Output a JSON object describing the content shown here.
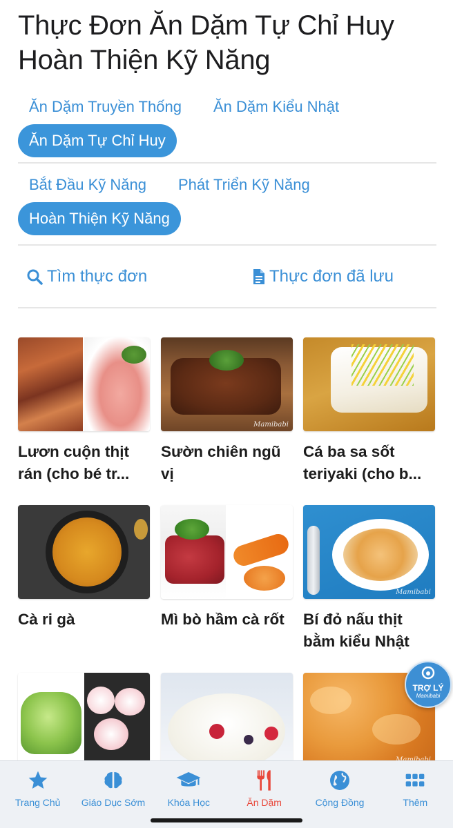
{
  "page": {
    "title": "Thực Đơn Ăn Dặm Tự Chỉ Huy Hoàn Thiện Kỹ Năng"
  },
  "styles": {
    "label": "",
    "options": [
      "Ăn Dặm Truyền Thống",
      "Ăn Dặm Kiểu Nhật",
      "Ăn Dặm Tự Chỉ Huy"
    ],
    "selected": "Ăn Dặm Tự Chỉ Huy"
  },
  "stages": {
    "options": [
      "Bắt Đầu Kỹ Năng",
      "Phát Triển Kỹ Năng",
      "Hoàn Thiện Kỹ Năng"
    ],
    "selected": "Hoàn Thiện Kỹ Năng"
  },
  "actions": {
    "search_label": "Tìm thực đơn",
    "saved_label": "Thực đơn đã lưu"
  },
  "recipes": [
    {
      "title": "Lươn cuộn thịt rán (cho bé tr...",
      "watermark": ""
    },
    {
      "title": "Sườn chiên ngũ vị",
      "watermark": "Mamibabi"
    },
    {
      "title": "Cá ba sa sốt teriyaki (cho b...",
      "watermark": ""
    },
    {
      "title": "Cà ri gà",
      "watermark": ""
    },
    {
      "title": "Mì bò hầm cà rốt",
      "watermark": ""
    },
    {
      "title": "Bí đỏ nấu thịt bằm kiểu Nhật",
      "watermark": "Mamibabi"
    },
    {
      "title": "",
      "watermark": ""
    },
    {
      "title": "",
      "watermark": ""
    },
    {
      "title": "",
      "watermark": "Mamibabi"
    }
  ],
  "assistant": {
    "label": "TRỢ LÝ",
    "brand": "Mamibabi"
  },
  "tabbar": {
    "items": [
      {
        "label": "Trang Chủ",
        "icon": "star-icon"
      },
      {
        "label": "Giáo Dục Sớm",
        "icon": "brain-icon"
      },
      {
        "label": "Khóa Học",
        "icon": "graduation-cap-icon"
      },
      {
        "label": "Ăn Dặm",
        "icon": "fork-knife-icon"
      },
      {
        "label": "Cộng Đồng",
        "icon": "globe-icon"
      },
      {
        "label": "Thêm",
        "icon": "grid-icon"
      }
    ],
    "active": "Ăn Dặm"
  },
  "colors": {
    "accent": "#3b95da",
    "active_tab": "#e8473a",
    "text": "#1c1c1c"
  }
}
